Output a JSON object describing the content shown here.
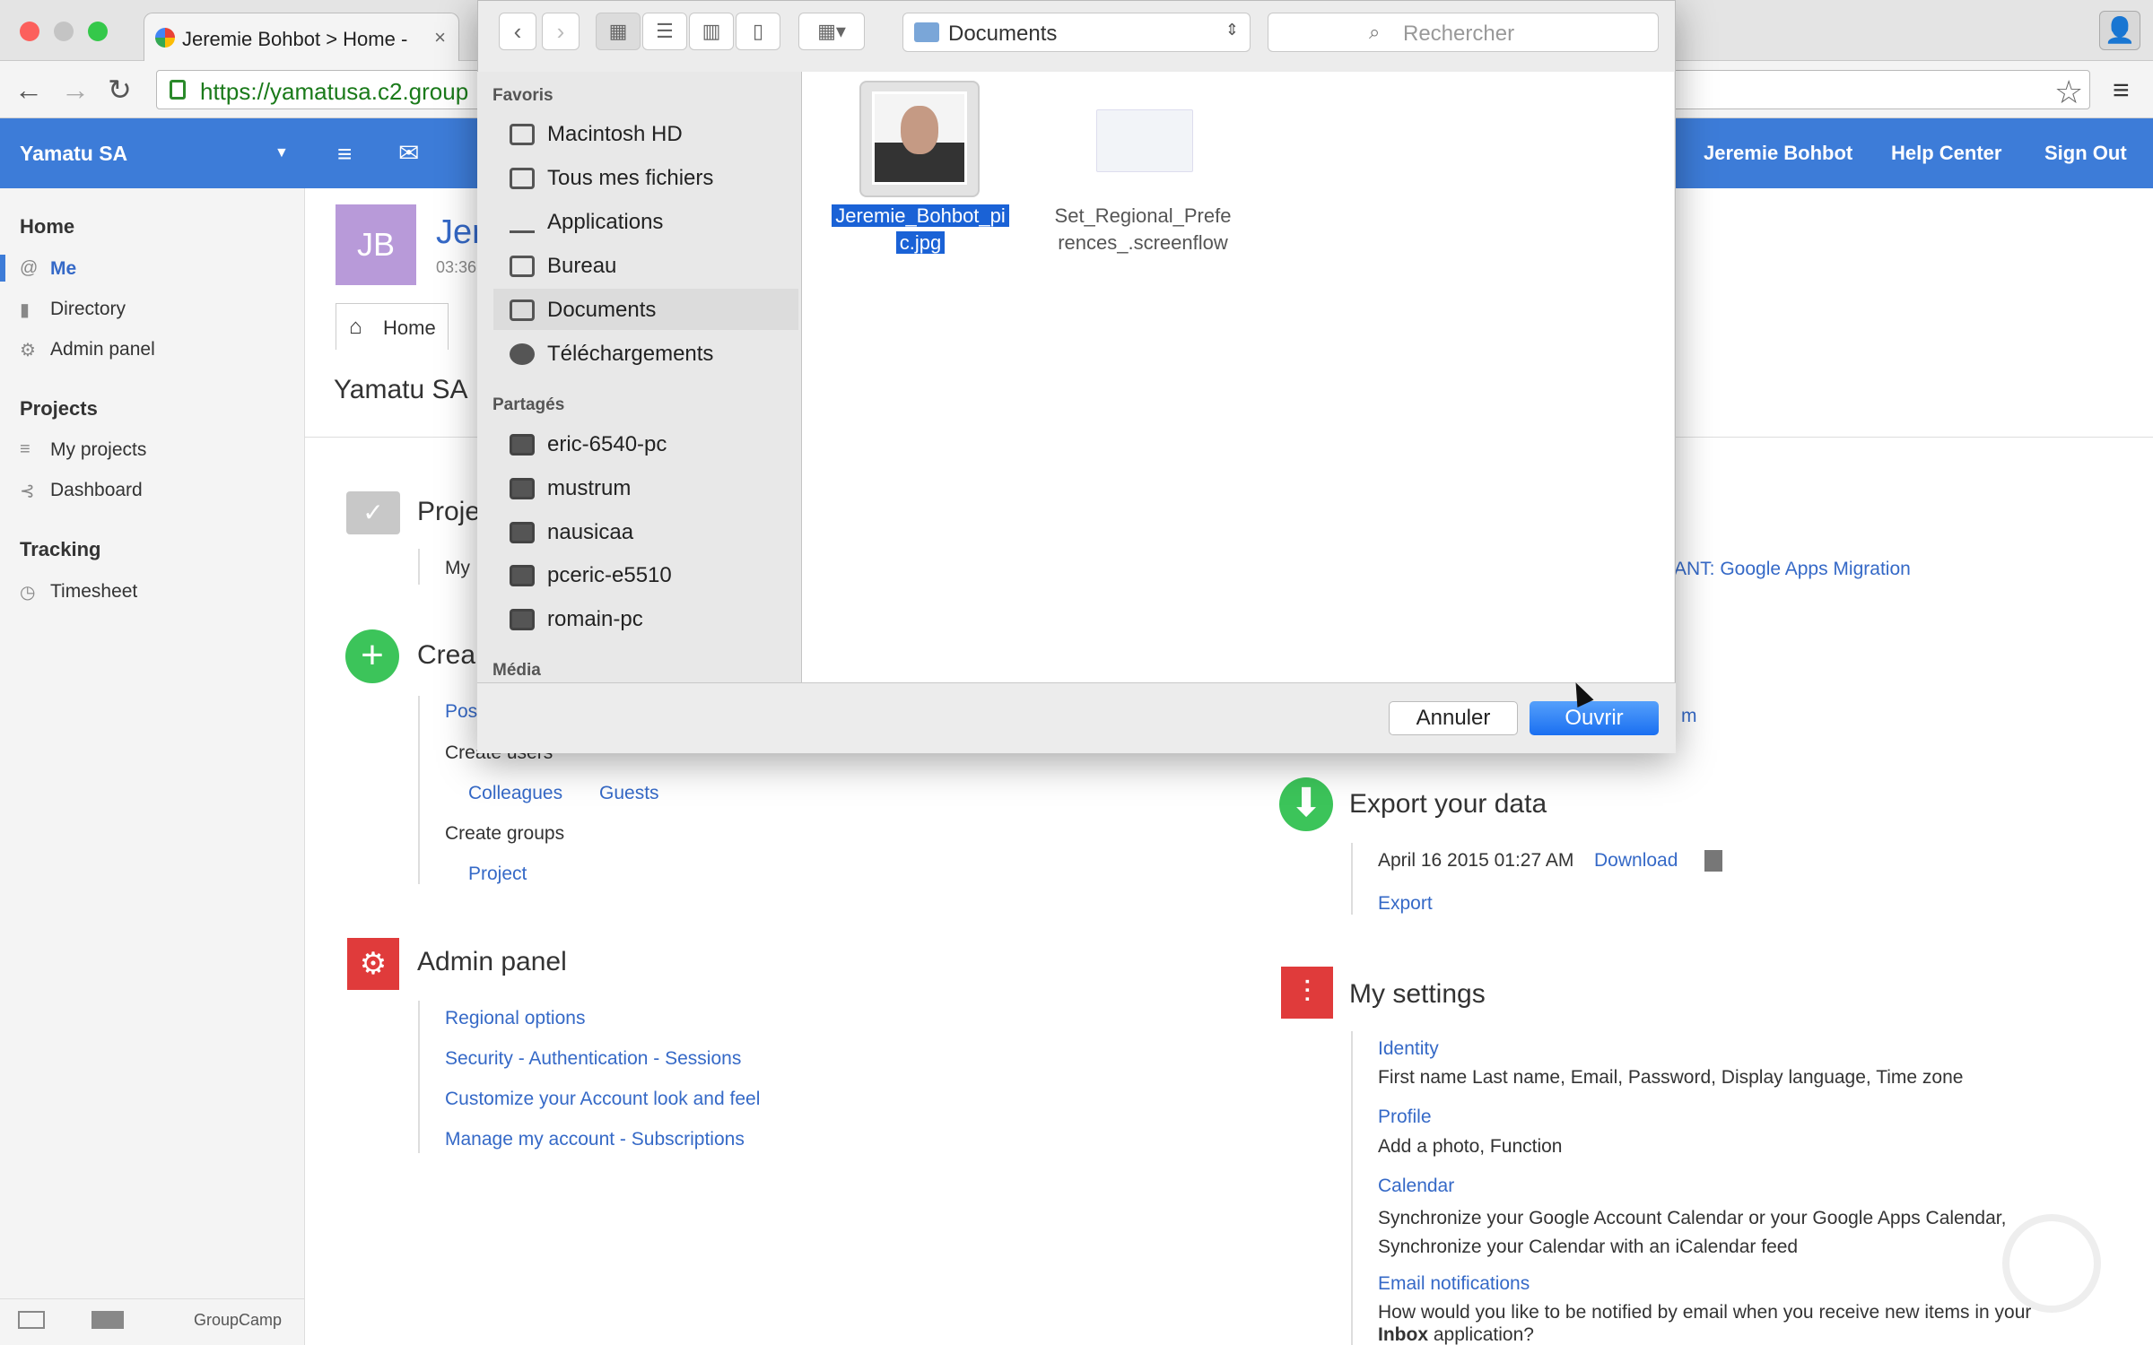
{
  "browser": {
    "tab_title": "Jeremie Bohbot > Home -",
    "tab_close": "×",
    "url": "https://yamatusa.c2.group",
    "back": "←",
    "forward": "→",
    "reload": "↻",
    "star": "☆",
    "menu": "≡",
    "profile": "👤"
  },
  "app": {
    "name": "Yamatu SA",
    "header_links": [
      "Jeremie Bohbot",
      "Help Center",
      "Sign Out"
    ],
    "header_icons": [
      "≡",
      "✉"
    ]
  },
  "sidebar": {
    "home": "Home",
    "home_items": [
      {
        "icon": "@",
        "label": "Me"
      },
      {
        "icon": "▮",
        "label": "Directory"
      },
      {
        "icon": "⚙",
        "label": "Admin panel"
      }
    ],
    "projects": "Projects",
    "project_items": [
      {
        "icon": "≡",
        "label": "My projects"
      },
      {
        "icon": "⊰",
        "label": "Dashboard"
      }
    ],
    "tracking": "Tracking",
    "tracking_items": [
      {
        "icon": "◷",
        "label": "Timesheet"
      }
    ],
    "footer": "GroupCamp"
  },
  "profile": {
    "initials": "JB",
    "name_partial": "Jer",
    "time_partial": "03:36"
  },
  "main": {
    "home_tab": "Home",
    "org_title": "Yamatu SA",
    "projects_heading": "Proje",
    "my_partial": "My",
    "project_link_partial": "ANT: Google Apps Migration",
    "create_heading": "Crea",
    "post_partial": "Pos",
    "create_users": "Create users",
    "colleagues": "Colleagues",
    "guests": "Guests",
    "create_groups": "Create groups",
    "project": "Project",
    "m_partial": "m",
    "admin_heading": "Admin panel",
    "admin_links": [
      "Regional options",
      "Security - Authentication - Sessions",
      "Customize your Account look and feel",
      "Manage my account - Subscriptions"
    ],
    "export_heading": "Export your data",
    "export_date": "April 16 2015 01:27 AM",
    "download": "Download",
    "export": "Export",
    "settings_heading": "My settings",
    "settings": [
      {
        "link": "Identity",
        "desc": "First name Last name, Email, Password, Display language, Time zone"
      },
      {
        "link": "Profile",
        "desc": "Add a photo, Function"
      },
      {
        "link": "Calendar",
        "desc": "Synchronize your Google Account Calendar or your Google Apps Calendar, Synchronize your Calendar with an iCalendar feed"
      },
      {
        "link": "Email notifications",
        "desc": "How would you like to be notified by email when you receive new items in your"
      }
    ],
    "inbox_bold": "Inbox",
    "inbox_rest": "application?"
  },
  "dialog": {
    "location": "Documents",
    "search_placeholder": "Rechercher",
    "favorites_label": "Favoris",
    "favorites": [
      "Macintosh HD",
      "Tous mes fichiers",
      "Applications",
      "Bureau",
      "Documents",
      "Téléchargements"
    ],
    "shared_label": "Partagés",
    "shared": [
      "eric-6540-pc",
      "mustrum",
      "nausicaa",
      "pceric-e5510",
      "romain-pc"
    ],
    "media_label": "Média",
    "files": [
      "Jeremie_Bohbot_pic.jpg",
      "Set_Regional_Preferences_.screenflow"
    ],
    "file1_lines": [
      "Jeremie_Bohbot_pi",
      "c.jpg"
    ],
    "file2_lines": [
      "Set_Regional_Prefe",
      "rences_.screenflow"
    ],
    "cancel": "Annuler",
    "open": "Ouvrir",
    "selected_sidebar": "Documents",
    "selected_file": "Jeremie_Bohbot_pic.jpg"
  }
}
